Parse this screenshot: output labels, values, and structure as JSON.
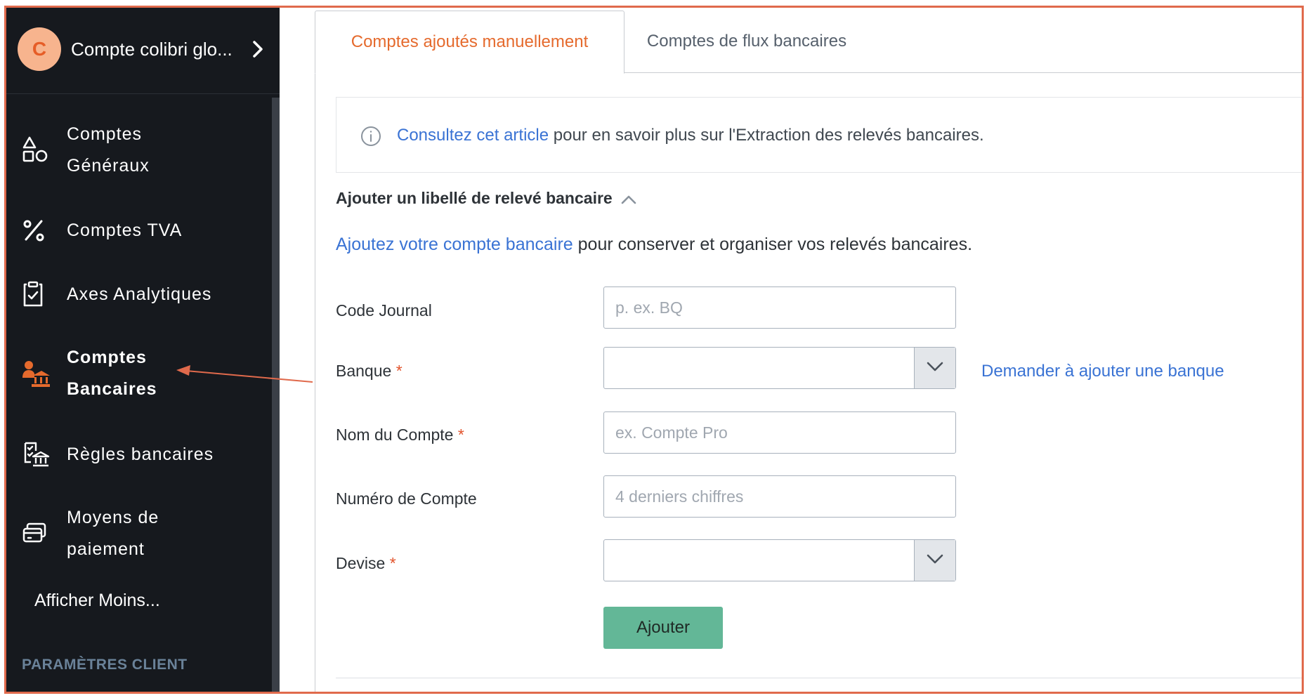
{
  "sidebar": {
    "account": {
      "initial": "C",
      "name": "Compte colibri glo..."
    },
    "items": [
      {
        "label_line1": "Comptes",
        "label_line2": "Généraux",
        "icon": "shapes-icon"
      },
      {
        "label": "Comptes TVA",
        "icon": "percent-icon"
      },
      {
        "label": "Axes Analytiques",
        "icon": "clipboard-check-icon"
      },
      {
        "label_line1": "Comptes",
        "label_line2": "Bancaires",
        "icon": "bank-users-icon",
        "active": true
      },
      {
        "label": "Règles bancaires",
        "icon": "bank-rules-icon"
      },
      {
        "label_line1": "Moyens de",
        "label_line2": "paiement",
        "icon": "payment-cards-icon"
      }
    ],
    "show_less": "Afficher Moins...",
    "section_title": "PARAMÈTRES CLIENT"
  },
  "tabs": [
    {
      "label": "Comptes ajoutés manuellement",
      "active": true
    },
    {
      "label": "Comptes de flux bancaires",
      "active": false
    }
  ],
  "info": {
    "link_text": "Consultez cet article",
    "text": " pour en savoir plus sur l'Extraction des relevés bancaires."
  },
  "section": {
    "toggle_label": "Ajouter un libellé de relevé bancaire"
  },
  "intro": {
    "link_text": "Ajoutez votre compte bancaire",
    "text": " pour conserver et organiser vos relevés bancaires."
  },
  "form": {
    "code_journal": {
      "label": "Code Journal",
      "placeholder": "p. ex. BQ",
      "value": ""
    },
    "banque": {
      "label": "Banque",
      "value": "",
      "required_mark": "*"
    },
    "request_bank_link": "Demander à ajouter une banque",
    "nom_compte": {
      "label": "Nom du Compte",
      "placeholder": "ex. Compte Pro",
      "value": "",
      "required_mark": "*"
    },
    "numero_compte": {
      "label": "Numéro de Compte",
      "placeholder": "4 derniers chiffres",
      "value": ""
    },
    "devise": {
      "label": "Devise",
      "value": "",
      "required_mark": "*"
    },
    "submit_label": "Ajouter"
  },
  "colors": {
    "accent": "#e56a2d",
    "link": "#3a73d4",
    "sidebar_bg": "#16191e",
    "button_bg": "#63b797",
    "annotation_frame": "#e06a4c"
  }
}
